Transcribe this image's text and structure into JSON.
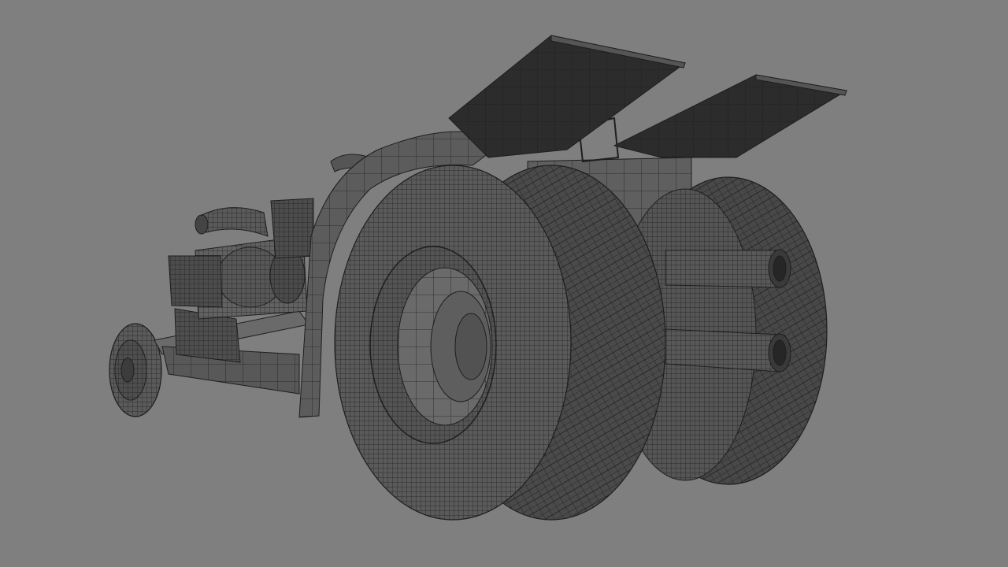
{
  "viewport": {
    "background": "#7f7f7f",
    "shading": "wireframe-on-shaded",
    "mesh_fill": "#5e5e5e",
    "mesh_dark": "#3c3c3c",
    "wire_color": "#1e1e1e"
  },
  "model": {
    "subject": "tractor-pull-tractor",
    "parts": [
      "front-wheel-icon",
      "chassis-frame",
      "engine-block",
      "intake-stacks",
      "turbo-pipe",
      "fender",
      "rear-wing-left",
      "rear-wing-right",
      "seat",
      "rear-tire-left",
      "rear-tire-right",
      "rear-hub",
      "exhaust-pipe-upper",
      "exhaust-pipe-lower"
    ]
  }
}
